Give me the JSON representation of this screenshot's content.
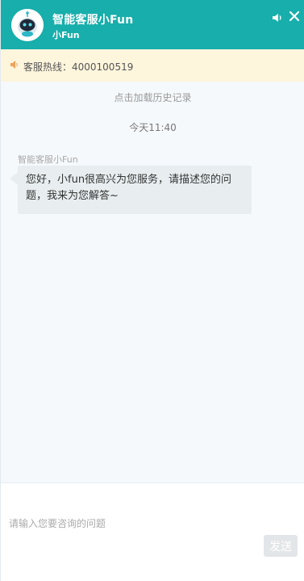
{
  "header": {
    "title": "智能客服小Fun",
    "subtitle": "小Fun",
    "background_color": "#17aeab",
    "avatar_icon": "robot-avatar-icon",
    "sound_icon": "volume-icon",
    "close_icon": "close-icon"
  },
  "hotline": {
    "icon": "speaker-icon",
    "text": "客服热线：4000100519",
    "icon_color": "#f0a25a",
    "background_color": "#fdf5dc"
  },
  "chat": {
    "load_history_label": "点击加载历史记录",
    "time_label": "今天11:40",
    "messages": [
      {
        "sender": "智能客服小Fun",
        "text": "您好，小fun很高兴为您服务，请描述您的问题，我来为您解答~"
      }
    ]
  },
  "composer": {
    "placeholder": "请输入您要咨询的问题",
    "value": "",
    "send_label": "发送"
  }
}
